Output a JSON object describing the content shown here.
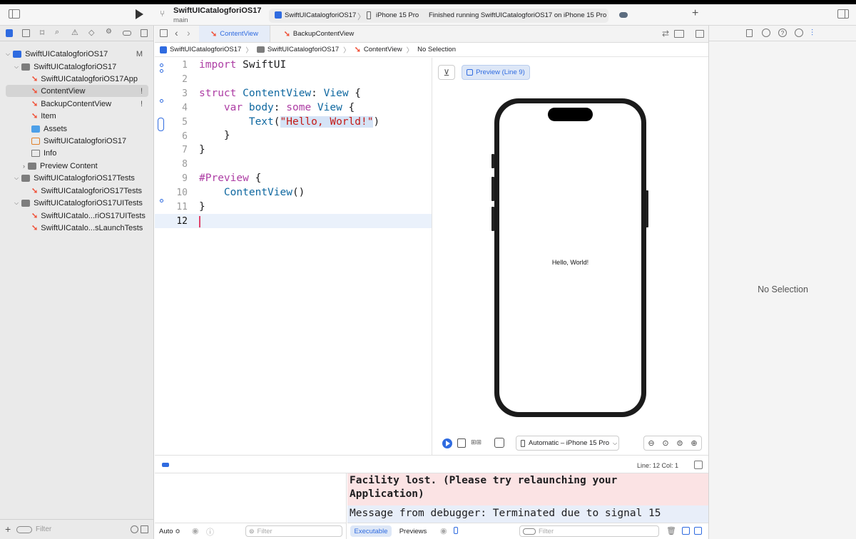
{
  "toolbar": {
    "project_name": "SwiftUICatalogforiOS17",
    "branch": "main",
    "scheme": "SwiftUICatalogforiOS17",
    "device": "iPhone 15 Pro",
    "status": "Finished running SwiftUICatalogforiOS17 on iPhone 15 Pro"
  },
  "navigator": {
    "items": [
      {
        "label": "SwiftUICatalogforiOS17",
        "badge": "M"
      },
      {
        "label": "SwiftUICatalogforiOS17",
        "badge": ""
      },
      {
        "label": "SwiftUICatalogforiOS17App",
        "badge": ""
      },
      {
        "label": "ContentView",
        "badge": "!"
      },
      {
        "label": "BackupContentView",
        "badge": "!"
      },
      {
        "label": "Item",
        "badge": ""
      },
      {
        "label": "Assets",
        "badge": ""
      },
      {
        "label": "SwiftUICatalogforiOS17",
        "badge": ""
      },
      {
        "label": "Info",
        "badge": ""
      },
      {
        "label": "Preview Content",
        "badge": ""
      },
      {
        "label": "SwiftUICatalogforiOS17Tests",
        "badge": ""
      },
      {
        "label": "SwiftUICatalogforiOS17Tests",
        "badge": ""
      },
      {
        "label": "SwiftUICatalogforiOS17UITests",
        "badge": ""
      },
      {
        "label": "SwiftUICatalo...riOS17UITests",
        "badge": ""
      },
      {
        "label": "SwiftUICatalo...sLaunchTests",
        "badge": ""
      }
    ],
    "filter_placeholder": "Filter"
  },
  "editor": {
    "tabs": [
      "ContentView",
      "BackupContentView"
    ],
    "breadcrumb": [
      "SwiftUICatalogforiOS17",
      "SwiftUICatalogforiOS17",
      "ContentView",
      "No Selection"
    ],
    "line_numbers": [
      "1",
      "2",
      "3",
      "4",
      "5",
      "6",
      "7",
      "8",
      "9",
      "10",
      "11",
      "12"
    ],
    "status": "Line: 12  Col: 1"
  },
  "preview": {
    "badge": "Preview (Line 9)",
    "screen_text": "Hello, World!",
    "device_picker": "Automatic – iPhone 15 Pro"
  },
  "debug": {
    "error_line1": "Facility lost. (Please try relaunching your",
    "error_line2": "Application)",
    "message": "Message from debugger: Terminated due to signal 15",
    "auto_label": "Auto ≎",
    "filter_placeholder": "Filter",
    "tab_executable": "Executable",
    "tab_previews": "Previews",
    "console_filter_placeholder": "Filter"
  },
  "inspector": {
    "empty_text": "No Selection"
  }
}
